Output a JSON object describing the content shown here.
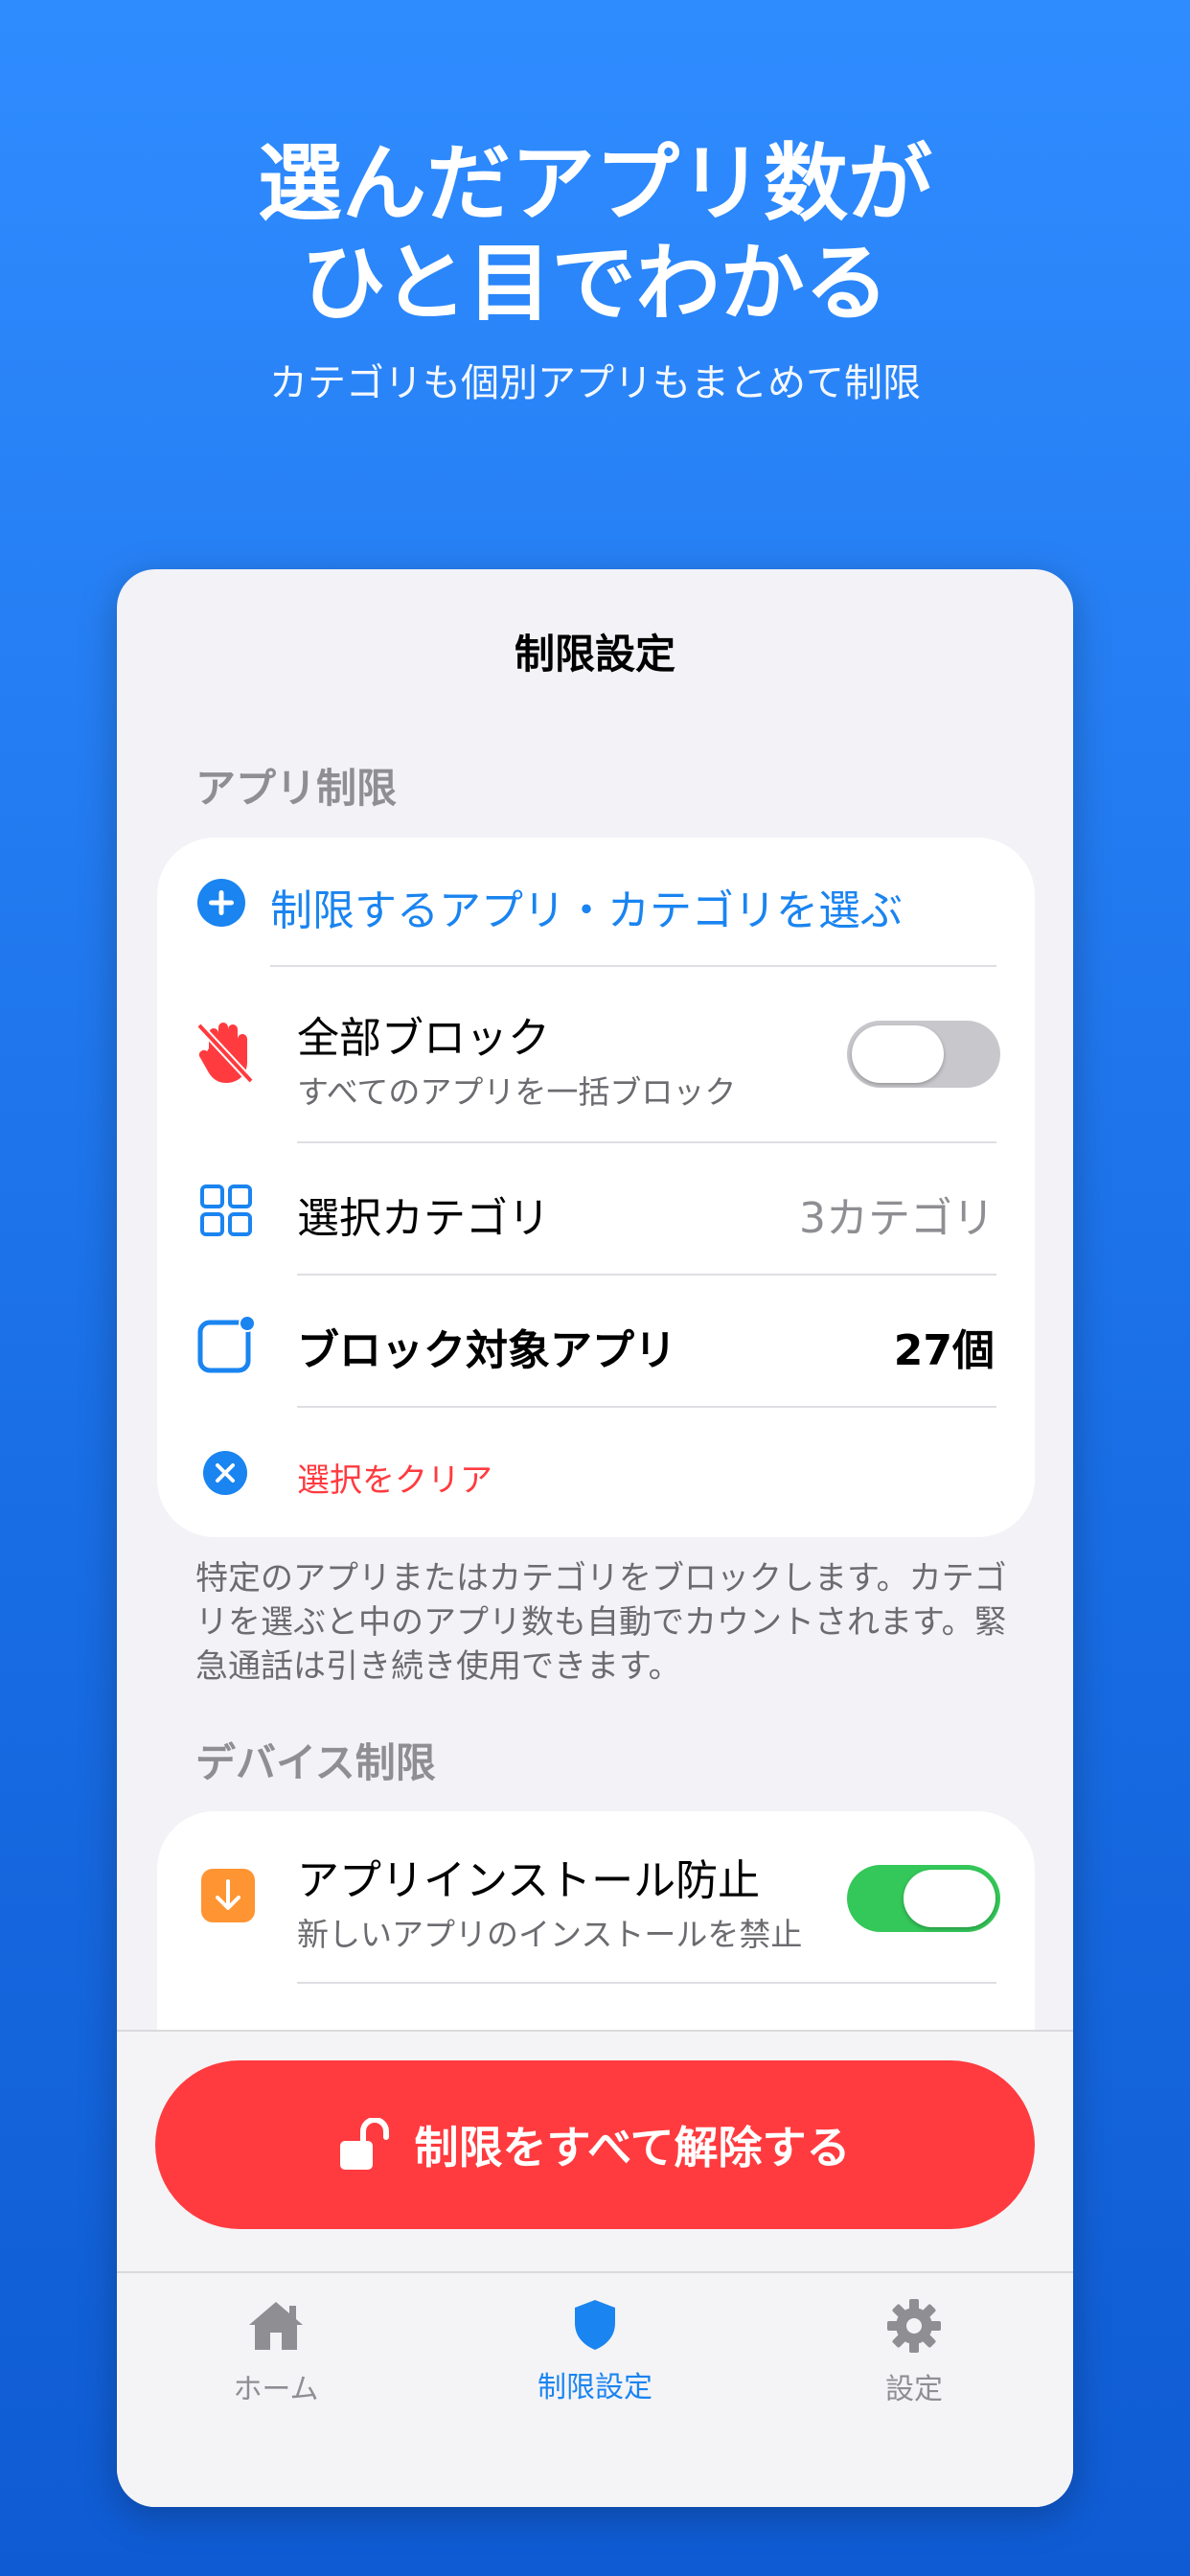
{
  "hero": {
    "headline_line1": "選んだアプリ数が",
    "headline_line2": "ひと目でわかる",
    "subheadline": "カテゴリも個別アプリもまとめて制限"
  },
  "screen": {
    "title": "制限設定",
    "app_section": {
      "header": "アプリ制限",
      "choose_label": "制限するアプリ・カテゴリを選ぶ",
      "block_all": {
        "title": "全部ブロック",
        "subtitle": "すべてのアプリを一括ブロック",
        "enabled": false
      },
      "selected_categories": {
        "title": "選択カテゴリ",
        "value": "3カテゴリ"
      },
      "blocked_apps": {
        "title": "ブロック対象アプリ",
        "value": "27個"
      },
      "clear_label": "選択をクリア",
      "footnote": "特定のアプリまたはカテゴリをブロックします。カテゴリを選ぶと中のアプリ数も自動でカウントされます。緊急通話は引き続き使用できます。"
    },
    "device_section": {
      "header": "デバイス制限",
      "install_prevent": {
        "title": "アプリインストール防止",
        "subtitle": "新しいアプリのインストールを禁止",
        "enabled": true
      }
    },
    "release_button": "制限をすべて解除する",
    "tabs": [
      {
        "label": "ホーム",
        "icon": "house-icon",
        "active": false
      },
      {
        "label": "制限設定",
        "icon": "shield-icon",
        "active": true
      },
      {
        "label": "設定",
        "icon": "gear-icon",
        "active": false
      }
    ]
  },
  "colors": {
    "accent": "#1a84f0",
    "danger": "#ff3b3f",
    "toggle_on": "#34c759",
    "toggle_off": "#c8c8cc",
    "install_icon": "#ff9432"
  }
}
